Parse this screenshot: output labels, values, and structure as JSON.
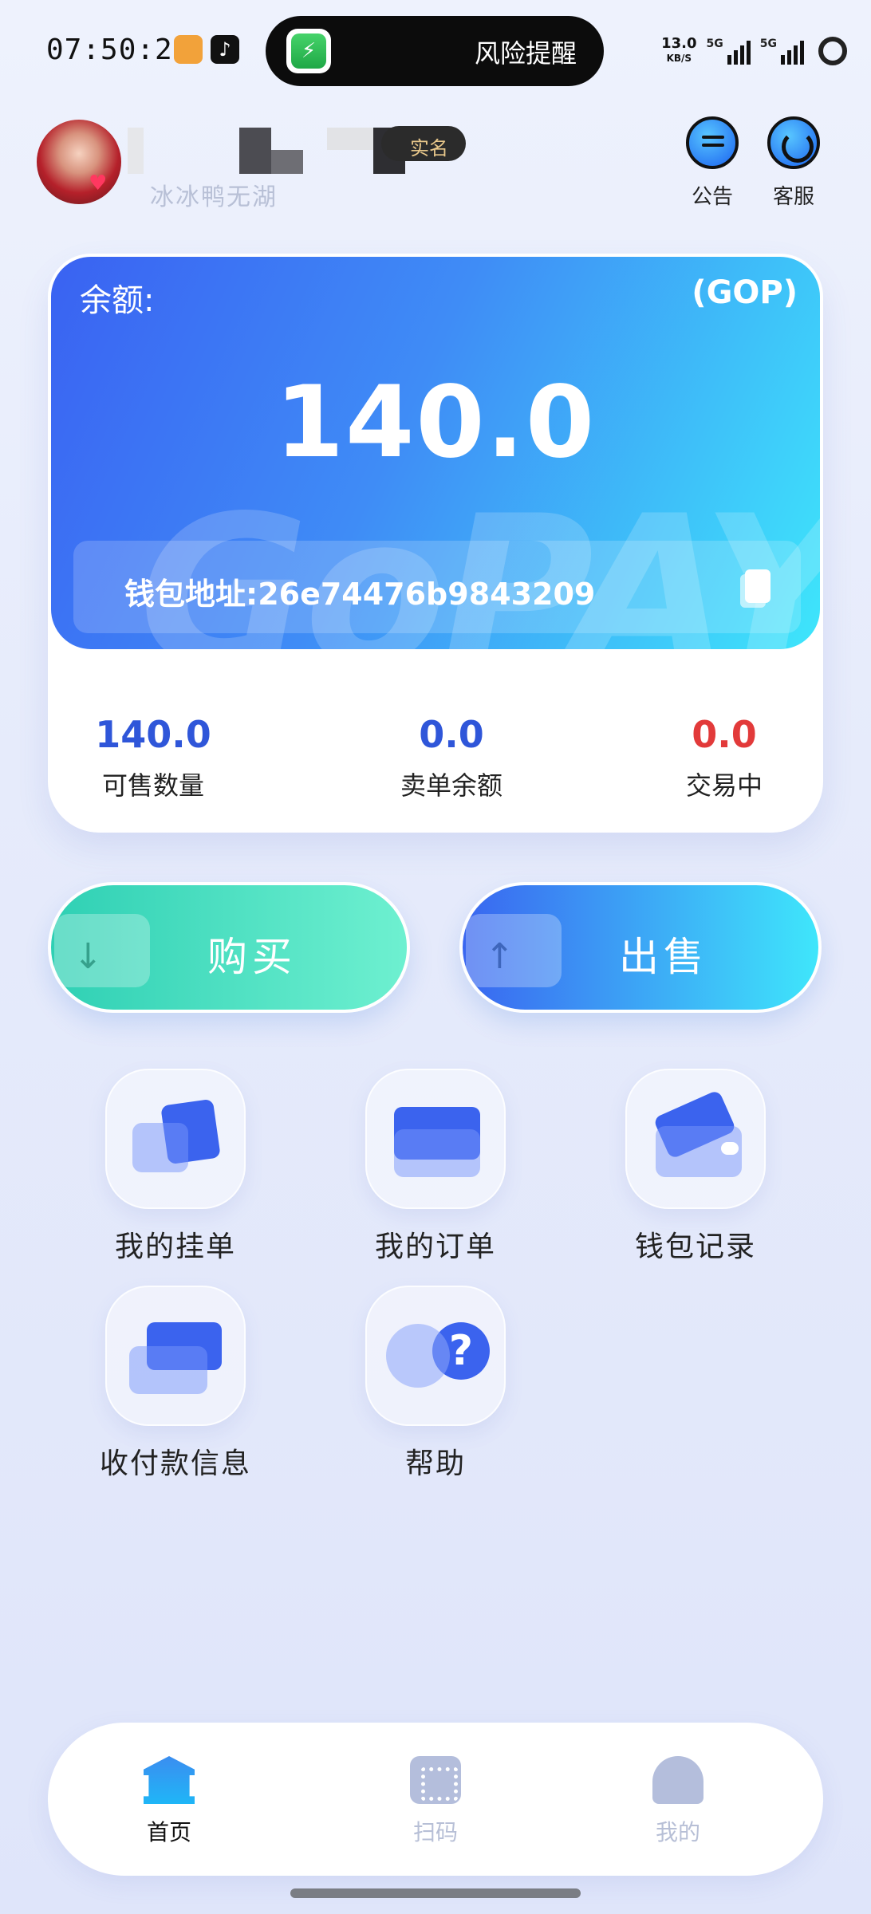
{
  "status_bar": {
    "time": "07:50:20",
    "island_text": "风险提醒",
    "net_speed_value": "13.0",
    "net_speed_unit": "KB/S",
    "signal_1": "5G",
    "signal_2": "5G"
  },
  "header": {
    "tag": "实名",
    "nickname": "冰冰鸭无湖",
    "notice_label": "公告",
    "service_label": "客服"
  },
  "balance_card": {
    "label": "余额:",
    "unit": "(GOP)",
    "amount": "140.0",
    "watermark": "GoPAY",
    "address_label": "钱包地址:",
    "address": "26e74476b9843209"
  },
  "stats": [
    {
      "value": "140.0",
      "label": "可售数量",
      "color": "#2f56d9"
    },
    {
      "value": "0.0",
      "label": "卖单余额",
      "color": "#2f56d9"
    },
    {
      "value": "0.0",
      "label": "交易中",
      "color": "#e23a3a"
    }
  ],
  "actions": {
    "buy_label": "购买",
    "sell_label": "出售"
  },
  "menu": [
    {
      "label": "我的挂单",
      "icon": "listing-card-icon"
    },
    {
      "label": "我的订单",
      "icon": "folder-icon"
    },
    {
      "label": "钱包记录",
      "icon": "wallet-icon"
    },
    {
      "label": "收付款信息",
      "icon": "payment-card-icon"
    },
    {
      "label": "帮助",
      "icon": "help-icon"
    }
  ],
  "bottom_nav": [
    {
      "label": "首页",
      "icon": "bank-icon",
      "active": true
    },
    {
      "label": "扫码",
      "icon": "qr-scan-icon",
      "active": false
    },
    {
      "label": "我的",
      "icon": "profile-icon",
      "active": false
    }
  ],
  "colors": {
    "accent": "#3b63ee",
    "buy_gradient_start": "#2fd0b4",
    "sell_gradient_end": "#3fe6fb",
    "danger": "#e23a3a"
  }
}
